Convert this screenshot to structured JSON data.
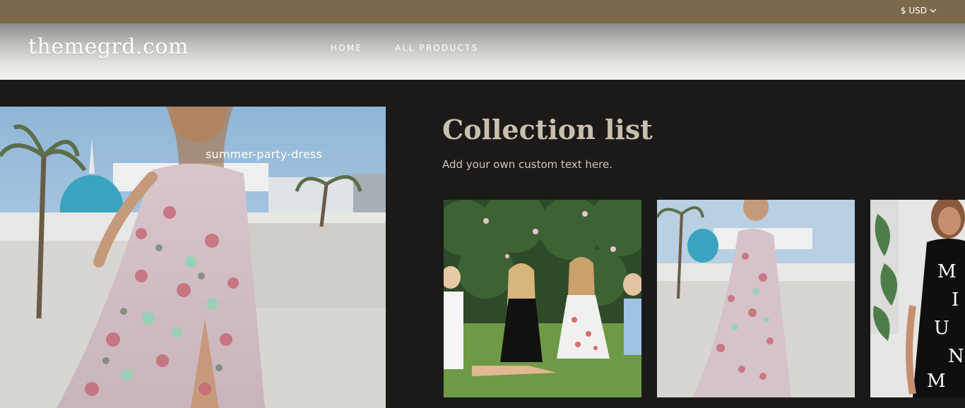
{
  "announcement": {
    "currency_label": "$ USD"
  },
  "header": {
    "logo": "themegrd.com",
    "nav": [
      {
        "label": "HOME"
      },
      {
        "label": "ALL PRODUCTS"
      }
    ]
  },
  "hero": {
    "caption": "summer-party-dress"
  },
  "collection": {
    "title": "Collection list",
    "subtitle": "Add your own custom text here."
  },
  "colors": {
    "announcement_bg": "#7a6a4b",
    "page_bg": "#1b1a19",
    "title_color": "#c8bfae"
  },
  "icons": {
    "currency_toggle": "chevron-down-icon"
  }
}
